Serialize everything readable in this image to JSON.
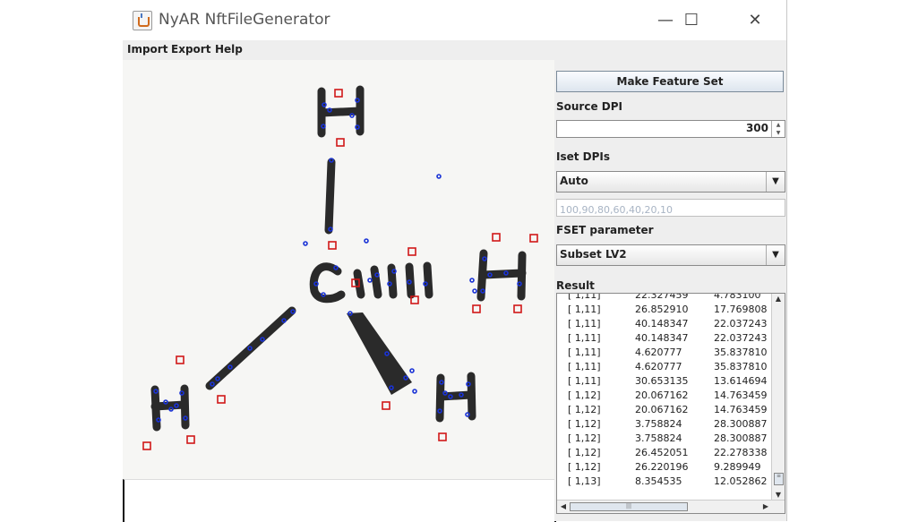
{
  "window": {
    "title": "NyAR NftFileGenerator",
    "controls": {
      "minimize": "—",
      "maximize": "☐",
      "close": "✕"
    }
  },
  "menu": {
    "items": [
      "Import",
      "Export",
      "Help"
    ]
  },
  "image_view": {
    "description_icon": "marker-image",
    "letters": [
      "H",
      "H",
      "H",
      "H",
      "C"
    ]
  },
  "panel": {
    "make_button": "Make Feature Set",
    "source_dpi_label": "Source DPI",
    "source_dpi_value": "300",
    "iset_label": "Iset DPIs",
    "iset_value": "Auto",
    "iset_placeholder": "100,90,80,60,40,20,10",
    "fset_label": "FSET parameter",
    "fset_value": "Subset LV2",
    "result_label": "Result",
    "results": [
      [
        "[ 1,11]",
        "22.327459",
        "4.783100"
      ],
      [
        "[ 1,11]",
        "26.852910",
        "17.769808"
      ],
      [
        "[ 1,11]",
        "40.148347",
        "22.037243"
      ],
      [
        "[ 1,11]",
        "40.148347",
        "22.037243"
      ],
      [
        "[ 1,11]",
        "4.620777",
        "35.837810"
      ],
      [
        "[ 1,11]",
        "4.620777",
        "35.837810"
      ],
      [
        "[ 1,11]",
        "30.653135",
        "13.614694"
      ],
      [
        "[ 1,12]",
        "20.067162",
        "14.763459"
      ],
      [
        "[ 1,12]",
        "20.067162",
        "14.763459"
      ],
      [
        "[ 1,12]",
        "3.758824",
        "28.300887"
      ],
      [
        "[ 1,12]",
        "3.758824",
        "28.300887"
      ],
      [
        "[ 1,12]",
        "26.452051",
        "22.278338"
      ],
      [
        "[ 1,12]",
        "26.220196",
        "9.289949"
      ],
      [
        "[ 1,13]",
        "8.354535",
        "12.052862"
      ]
    ]
  },
  "colors": {
    "ink": "#2a2a2a",
    "feature_point": "#1a33d6",
    "template_box": "#d01818",
    "panel_bg": "#eeeeee"
  }
}
